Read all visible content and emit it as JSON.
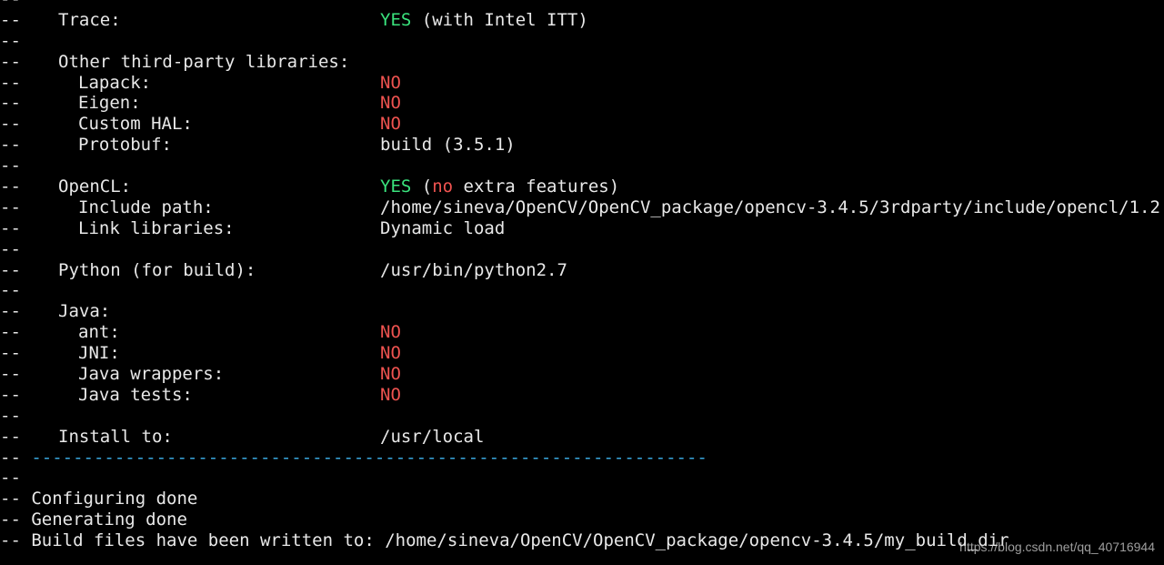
{
  "terminal": {
    "prefix": "--",
    "trace_label": "Trace:",
    "trace_status": "YES",
    "trace_detail": " (with Intel ITT)",
    "other_label": "Other third-party libraries:",
    "lapack_label": "Lapack:",
    "lapack_val": "NO",
    "eigen_label": "Eigen:",
    "eigen_val": "NO",
    "hal_label": "Custom HAL:",
    "hal_val": "NO",
    "protobuf_label": "Protobuf:",
    "protobuf_val": "build (3.5.1)",
    "opencl_label": "OpenCL:",
    "opencl_status": "YES",
    "opencl_paren_open": " (",
    "opencl_no": "no",
    "opencl_rest": " extra features)",
    "include_label": "Include path:",
    "include_val": "/home/sineva/OpenCV/OpenCV_package/opencv-3.4.5/3rdparty/include/opencl/1.2",
    "link_label": "Link libraries:",
    "link_val": "Dynamic load",
    "python_label": "Python (for build):",
    "python_val": "/usr/bin/python2.7",
    "java_label": "Java:",
    "ant_label": "ant:",
    "ant_val": "NO",
    "jni_label": "JNI:",
    "jni_val": "NO",
    "wrappers_label": "Java wrappers:",
    "wrappers_val": "NO",
    "tests_label": "Java tests:",
    "tests_val": "NO",
    "install_label": "Install to:",
    "install_val": "/usr/local",
    "separator_prefix": "-- ",
    "separator": "-----------------------------------------------------------------",
    "configuring": "-- Configuring done",
    "generating": "-- Generating done",
    "build_files": "-- Build files have been written to: /home/sineva/OpenCV/OpenCV_package/opencv-3.4.5/my_build_dir"
  },
  "watermark": "https://blog.csdn.net/qq_40716944",
  "colors": {
    "background": "#000000",
    "text": "#e8e8e8",
    "yes": "#3ae37d",
    "no": "#ef5350",
    "separator": "#3aa9e0"
  }
}
